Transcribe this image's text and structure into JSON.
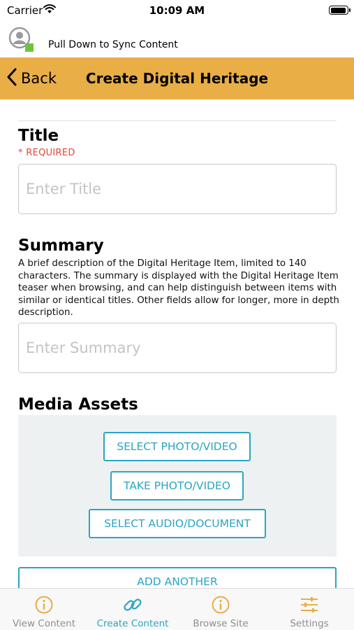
{
  "status_bar": {
    "carrier": "Carrier",
    "time": "10:09 AM"
  },
  "sync": {
    "text": "Pull Down to Sync Content"
  },
  "nav": {
    "back_label": "Back",
    "title": "Create Digital Heritage"
  },
  "form": {
    "title": {
      "label": "Title",
      "required": "* REQUIRED",
      "placeholder": "Enter Title",
      "value": ""
    },
    "summary": {
      "label": "Summary",
      "description": "A brief description of the Digital Heritage Item, limited to 140 characters. The summary is displayed with the Digital Heritage Item teaser when browsing, and can help distinguish between items with similar or identical titles. Other fields allow for longer, more in depth description.",
      "placeholder": "Enter Summary",
      "value": ""
    },
    "media": {
      "label": "Media Assets",
      "buttons": [
        "SELECT PHOTO/VIDEO",
        "TAKE PHOTO/VIDEO",
        "SELECT AUDIO/DOCUMENT"
      ],
      "add_another": "ADD ANOTHER"
    }
  },
  "tabs": [
    {
      "label": "View Content",
      "icon": "info-circle-icon",
      "active": false
    },
    {
      "label": "Create Content",
      "icon": "link-icon",
      "active": true
    },
    {
      "label": "Browse Site",
      "icon": "info-circle-icon",
      "active": false
    },
    {
      "label": "Settings",
      "icon": "sliders-icon",
      "active": false
    }
  ],
  "colors": {
    "header_bg": "#E9AE46",
    "accent_teal": "#2AA5C4",
    "required_red": "#E0463C",
    "tab_active": "#2AA5C4",
    "tab_inactive": "#8E8E93",
    "tab_icon_inactive": "#E9AE46",
    "media_box_bg": "#EEF1F1",
    "sync_status_green": "#6BC53C"
  }
}
